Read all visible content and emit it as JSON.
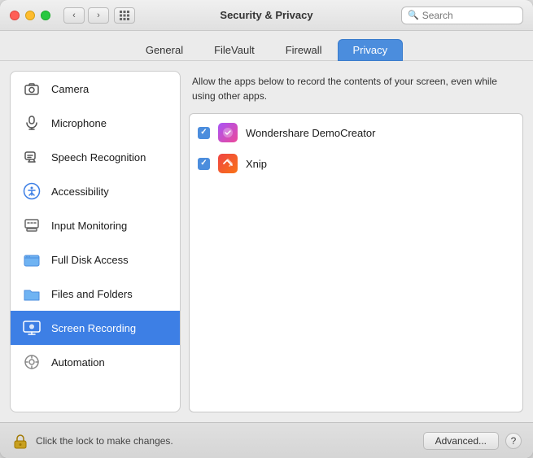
{
  "window": {
    "title": "Security & Privacy"
  },
  "search": {
    "placeholder": "Search"
  },
  "tabs": [
    {
      "id": "general",
      "label": "General"
    },
    {
      "id": "filevault",
      "label": "FileVault"
    },
    {
      "id": "firewall",
      "label": "Firewall"
    },
    {
      "id": "privacy",
      "label": "Privacy",
      "active": true
    }
  ],
  "sidebar": {
    "items": [
      {
        "id": "camera",
        "label": "Camera"
      },
      {
        "id": "microphone",
        "label": "Microphone"
      },
      {
        "id": "speech",
        "label": "Speech Recognition"
      },
      {
        "id": "accessibility",
        "label": "Accessibility"
      },
      {
        "id": "input-monitoring",
        "label": "Input Monitoring"
      },
      {
        "id": "full-disk",
        "label": "Full Disk Access"
      },
      {
        "id": "files-folders",
        "label": "Files and Folders"
      },
      {
        "id": "screen-recording",
        "label": "Screen Recording",
        "selected": true
      },
      {
        "id": "automation",
        "label": "Automation"
      }
    ]
  },
  "main": {
    "description": "Allow the apps below to record the contents of your screen, even while using other apps.",
    "apps": [
      {
        "id": "wondershare",
        "name": "Wondershare DemoCreator",
        "checked": true
      },
      {
        "id": "xnip",
        "name": "Xnip",
        "checked": true
      }
    ]
  },
  "footer": {
    "lock_text": "Click the lock to make changes.",
    "advanced_btn": "Advanced...",
    "help_btn": "?"
  }
}
